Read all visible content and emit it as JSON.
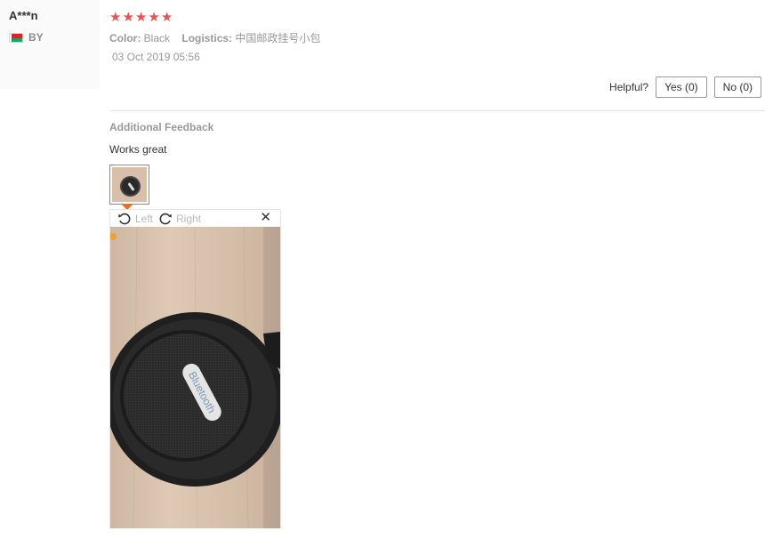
{
  "user": {
    "name": "A***n",
    "country_code": "BY",
    "flag_icon": "belarus-flag-icon"
  },
  "review": {
    "rating": 5,
    "rating_max": 5,
    "star_color": "#f0504f",
    "color_label": "Color:",
    "color_value": "Black",
    "logistics_label": "Logistics:",
    "logistics_value": "中国邮政挂号小包",
    "date": "03 Oct 2019 05:56"
  },
  "helpful": {
    "label": "Helpful?",
    "yes_label": "Yes (0)",
    "no_label": "No (0)"
  },
  "additional_feedback": {
    "title": "Additional Feedback",
    "text": "Works great"
  },
  "viewer": {
    "rotate_left_label": "Left",
    "rotate_right_label": "Right",
    "close_icon": "close-icon",
    "photo_label": "Bluetooth",
    "accent_color": "#f06b1c"
  }
}
